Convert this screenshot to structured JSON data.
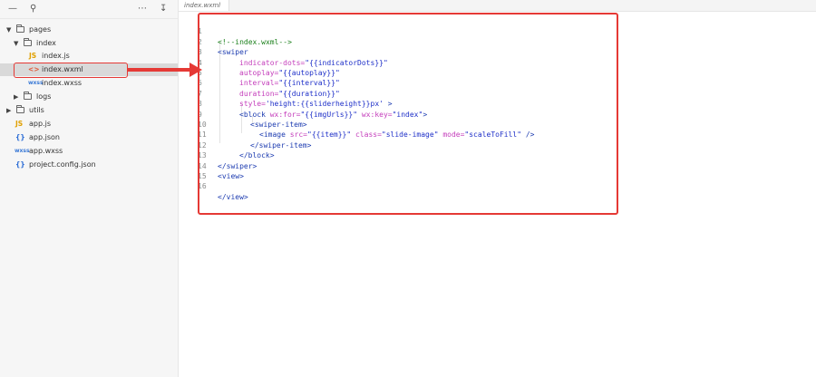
{
  "toolbar": {
    "icons": [
      "minus-icon",
      "search-icon",
      "more-icon",
      "collapse-icon"
    ]
  },
  "tree": {
    "items": [
      {
        "label": "pages",
        "type": "folder"
      },
      {
        "label": "index",
        "type": "folder"
      },
      {
        "label": "index.js",
        "type": "js",
        "badge": "JS"
      },
      {
        "label": "index.wxml",
        "type": "wxml",
        "badge": "<>"
      },
      {
        "label": "index.wxss",
        "type": "wxss",
        "badge": "wxss"
      },
      {
        "label": "logs",
        "type": "folder"
      },
      {
        "label": "utils",
        "type": "folder"
      },
      {
        "label": "app.js",
        "type": "js",
        "badge": "JS"
      },
      {
        "label": "app.json",
        "type": "json",
        "badge": "{}"
      },
      {
        "label": "app.wxss",
        "type": "wxss",
        "badge": "wxss"
      },
      {
        "label": "project.config.json",
        "type": "json",
        "badge": "{}"
      }
    ]
  },
  "editor": {
    "tab_label": "index.wxml",
    "lines": [
      {
        "n": "1"
      },
      {
        "n": "2"
      },
      {
        "n": "3"
      },
      {
        "n": "4"
      },
      {
        "n": "5"
      },
      {
        "n": "6"
      },
      {
        "n": "7"
      },
      {
        "n": "8"
      },
      {
        "n": "9"
      },
      {
        "n": "10"
      },
      {
        "n": "11"
      },
      {
        "n": "12"
      },
      {
        "n": "13"
      },
      {
        "n": "14"
      },
      {
        "n": "15"
      },
      {
        "n": "16"
      }
    ],
    "code": {
      "l1": "<!--index.wxml-->",
      "l2_tag": "<swiper",
      "l3_attr": "indicator-dots=",
      "l3_val": "\"{{indicatorDots}}\"",
      "l4_attr": "autoplay=",
      "l4_val": "\"{{autoplay}}\"",
      "l5_attr": "interval=",
      "l5_val": "\"{{interval}}\"",
      "l6_attr": "duration=",
      "l6_val": "\"{{duration}}\"",
      "l7_attr": "style=",
      "l7_val": "'height:{{sliderheight}}px'",
      "l7_end": " >",
      "l8_tag": "<block",
      "l8_attr1": " wx:for=",
      "l8_val1": "\"{{imgUrls}}\"",
      "l8_attr2": " wx:key=",
      "l8_val2": "\"index\"",
      "l8_end": ">",
      "l9": "<swiper-item>",
      "l10_tag": "<image",
      "l10_attr1": " src=",
      "l10_val1": "\"{{item}}\"",
      "l10_attr2": " class=",
      "l10_val2": "\"slide-image\"",
      "l10_attr3": " mode=",
      "l10_val3": "\"scaleToFill\"",
      "l10_end": " />",
      "l11": "</swiper-item>",
      "l12": "</block>",
      "l13": "</swiper>",
      "l14": "<view>",
      "l15": "",
      "l16": "</view>"
    }
  },
  "colors": {
    "highlight": "#e53935",
    "tag": "#1c3bb0",
    "attribute": "#c43dbb",
    "string": "#1e2fc8",
    "comment": "#1a7f1a"
  }
}
